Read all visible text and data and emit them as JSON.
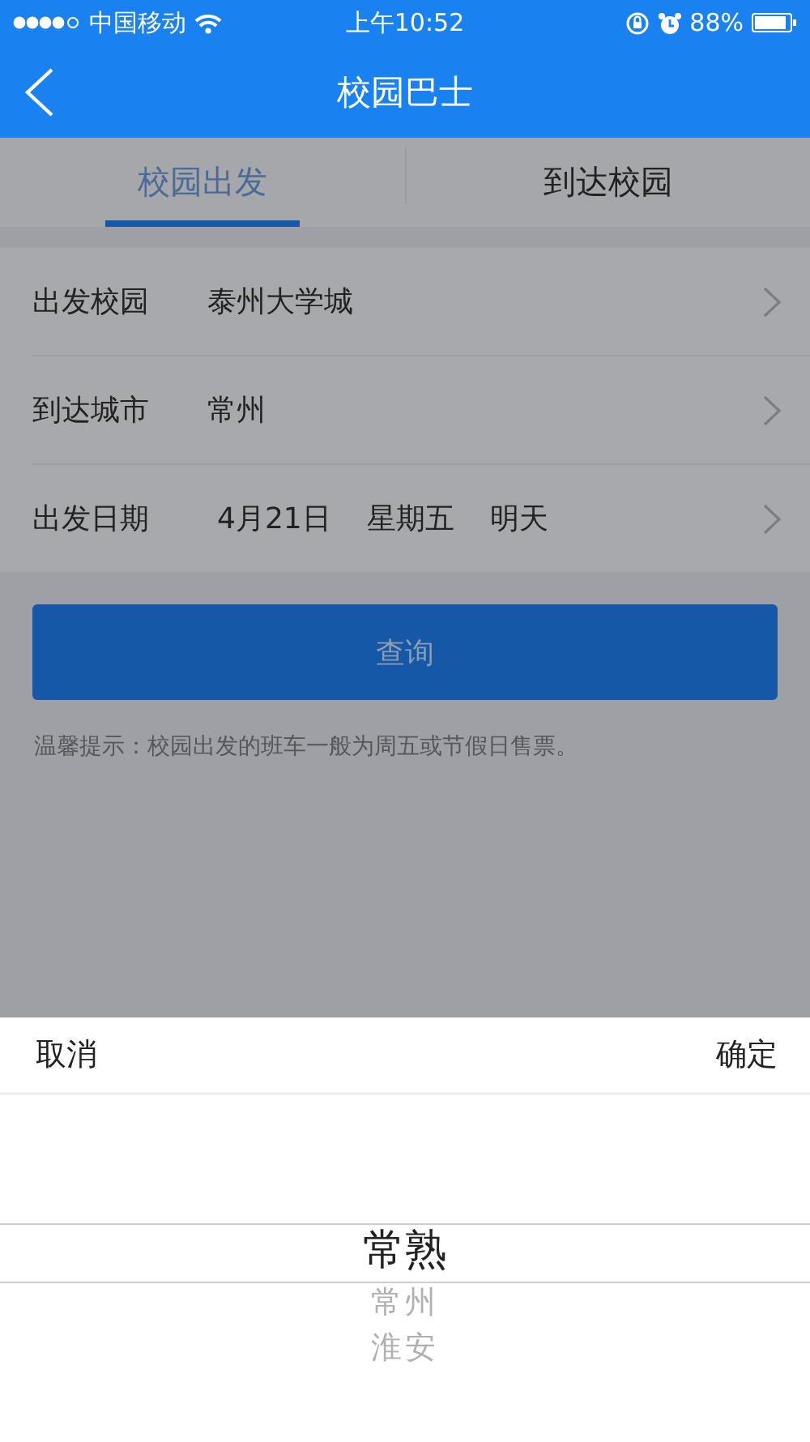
{
  "status_bar": {
    "carrier": "中国移动",
    "time": "上午10:52",
    "battery": "88%"
  },
  "nav": {
    "title": "校园巴士"
  },
  "tabs": [
    {
      "label": "校园出发",
      "selected": true
    },
    {
      "label": "到达校园",
      "selected": false
    }
  ],
  "form": [
    {
      "label": "出发校园",
      "values": [
        "泰州大学城"
      ]
    },
    {
      "label": "到达城市",
      "values": [
        "常州"
      ]
    },
    {
      "label": "出发日期",
      "values": [
        "4月21日",
        "星期五",
        "明天"
      ]
    }
  ],
  "query_button": "查询",
  "tip": "温馨提示：校园出发的班车一般为周五或节假日售票。",
  "picker": {
    "cancel": "取消",
    "confirm": "确定",
    "options": [
      {
        "label": "常熟",
        "selected": true
      },
      {
        "label": "常州",
        "selected": false
      },
      {
        "label": "淮安",
        "selected": false
      }
    ]
  }
}
